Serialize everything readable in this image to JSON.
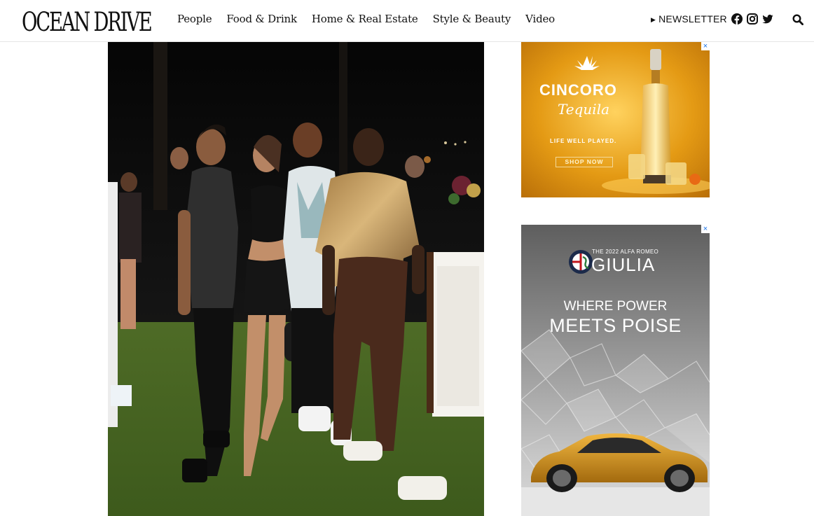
{
  "site": {
    "logo": "OCEAN DRIVE"
  },
  "nav": {
    "items": [
      {
        "label": "People"
      },
      {
        "label": "Food & Drink"
      },
      {
        "label": "Home & Real Estate"
      },
      {
        "label": "Style & Beauty"
      },
      {
        "label": "Video"
      }
    ],
    "newsletter_label": "NEWSLETTER",
    "social_icons": [
      "facebook-icon",
      "instagram-icon",
      "twitter-icon"
    ],
    "search_icon": "search-icon"
  },
  "article": {
    "photo_icon": "event-photo"
  },
  "ads": {
    "cincoro": {
      "brand": "CINCORO",
      "sub": "Tequila",
      "tagline": "LIFE WELL PLAYED.",
      "cta": "SHOP NOW",
      "close_glyph": "×",
      "colors": {
        "background": "#e09a18",
        "accent": "#ffd76a"
      }
    },
    "giulia": {
      "small": "THE 2022 ALFA ROMEO",
      "name": "GIULIA",
      "headline_1": "WHERE POWER",
      "headline_2": "MEETS POISE",
      "close_glyph": "×",
      "colors": {
        "car": "#d89a1e",
        "background": "#8f8f8f"
      }
    }
  }
}
